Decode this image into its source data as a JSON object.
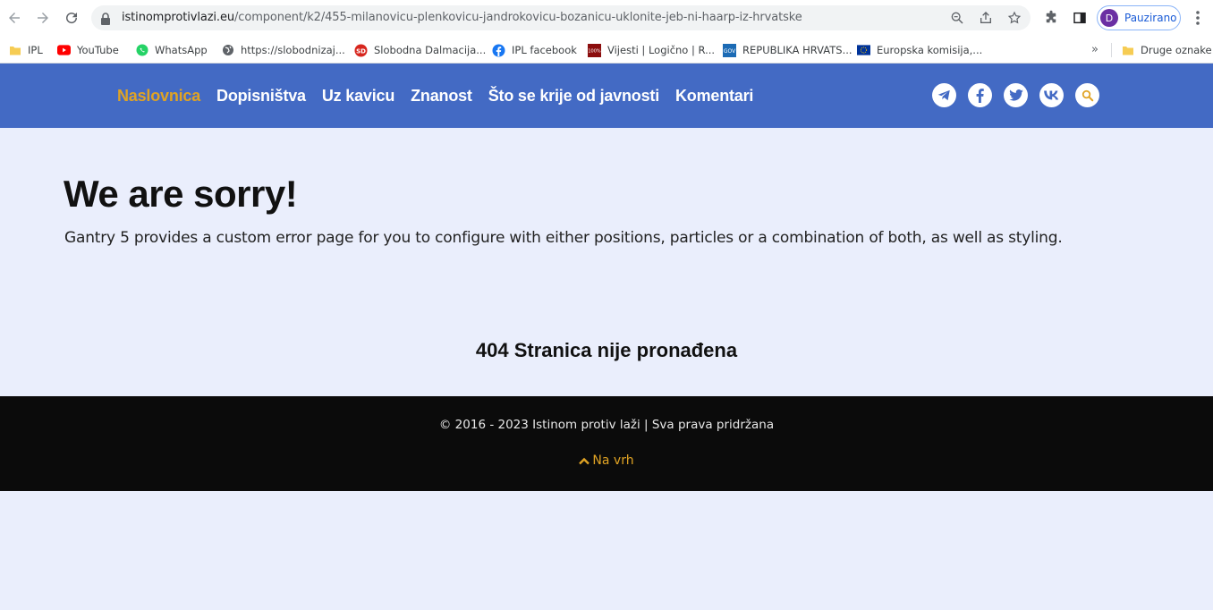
{
  "browser": {
    "url_host": "istinomprotivlazi.eu",
    "url_path": "/component/k2/455-milanovicu-plenkovicu-jandrokovicu-bozanicu-uklonite-jeb-ni-haarp-iz-hrvatske",
    "profile_initial": "D",
    "profile_label": "Pauzirano"
  },
  "bookmarks": [
    {
      "label": "IPL",
      "icon": "folder-icon"
    },
    {
      "label": "YouTube",
      "icon": "youtube-icon"
    },
    {
      "label": "WhatsApp",
      "icon": "whatsapp-icon"
    },
    {
      "label": "https://slobodnizaj...",
      "icon": "globe-icon"
    },
    {
      "label": "Slobodna Dalmacija...",
      "icon": "sd-icon"
    },
    {
      "label": "IPL facebook",
      "icon": "facebook-icon"
    },
    {
      "label": "Vijesti | Logično | R...",
      "icon": "logicno-icon"
    },
    {
      "label": "REPUBLIKA HRVATS...",
      "icon": "hr-icon"
    },
    {
      "label": "Europska komisija,...",
      "icon": "eu-flag-icon"
    }
  ],
  "bookmarks_more": "»",
  "bookmarks_other": "Druge oznake",
  "menu": [
    {
      "label": "Naslovnica",
      "active": true
    },
    {
      "label": "Dopisništva",
      "active": false
    },
    {
      "label": "Uz kavicu",
      "active": false
    },
    {
      "label": "Znanost",
      "active": false
    },
    {
      "label": "Što se krije od javnosti",
      "active": false
    },
    {
      "label": "Komentari",
      "active": false
    }
  ],
  "social": [
    "telegram-icon",
    "facebook-icon",
    "twitter-icon",
    "vk-icon",
    "search-icon"
  ],
  "error": {
    "title": "We are sorry!",
    "text": "Gantry 5 provides a custom error page for you to configure with either positions, particles or a combination of both, as well as styling.",
    "not_found": "404 Stranica nije pronađena"
  },
  "footer": {
    "copyright": "© 2016 - 2023 Istinom protiv laži | Sva prava pridržana",
    "to_top": "Na vrh"
  },
  "colors": {
    "header_bg": "#436ac4",
    "accent": "#e0a324",
    "page_bg": "#eaeefc",
    "footer_bg": "#0b0b0b"
  }
}
